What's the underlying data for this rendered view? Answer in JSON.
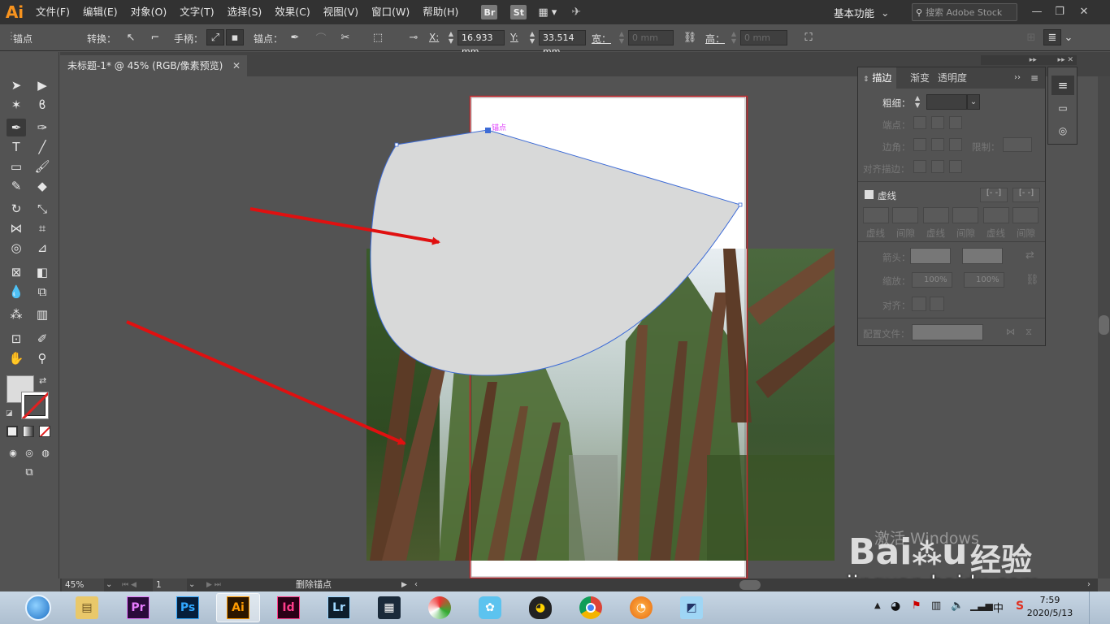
{
  "app": {
    "logo": "Ai"
  },
  "menubar": {
    "items": [
      "文件(F)",
      "编辑(E)",
      "对象(O)",
      "文字(T)",
      "选择(S)",
      "效果(C)",
      "视图(V)",
      "窗口(W)",
      "帮助(H)"
    ],
    "bridge": "Br",
    "stock": "St",
    "workspace": "基本功能",
    "search_placeholder": "搜索 Adobe Stock"
  },
  "control_bar": {
    "mode": "锚点",
    "convert_label": "转换：",
    "handles_label": "手柄：",
    "anchor_label": "锚点：",
    "x_label": "X:",
    "x_value": "16.933 mm",
    "y_label": "Y:",
    "y_value": "33.514 mm",
    "w_label": "宽：",
    "w_value": "0 mm",
    "h_label": "高：",
    "h_value": "0 mm"
  },
  "document": {
    "tab_title": "未标题-1* @ 45% (RGB/像素预览)",
    "anchor_tooltip": "锚点"
  },
  "stroke_panel": {
    "tabs": [
      "描边",
      "渐变",
      "透明度"
    ],
    "weight_label": "粗细：",
    "cap_label": "端点：",
    "corner_label": "边角：",
    "limit_label": "限制：",
    "align_label": "对齐描边：",
    "dashed_label": "虚线",
    "dash_cols": [
      "虚线",
      "间隙",
      "虚线",
      "间隙",
      "虚线",
      "间隙"
    ],
    "arrow_label": "箭头：",
    "scale_label": "缩放：",
    "scale_values": [
      "100%",
      "100%"
    ],
    "align2_label": "对齐：",
    "profile_label": "配置文件："
  },
  "status_bar": {
    "zoom": "45%",
    "artboard": "1",
    "tool_status": "删除锚点"
  },
  "taskbar": {
    "apps": [
      "Pr",
      "Ps",
      "Ai",
      "Id",
      "Lr"
    ],
    "time": "7:59",
    "date": "2020/5/13",
    "ime": "中"
  },
  "watermark": {
    "activate": "激活 Windows",
    "brand": "经验",
    "url": "jingyan.baidu.com"
  },
  "colors": {
    "accent_ai": "#f7931e",
    "artboard_border": "#c1272d",
    "shape_fill": "#d8d9d9",
    "path_stroke": "#3d6bd6",
    "arrow": "#e01010"
  }
}
